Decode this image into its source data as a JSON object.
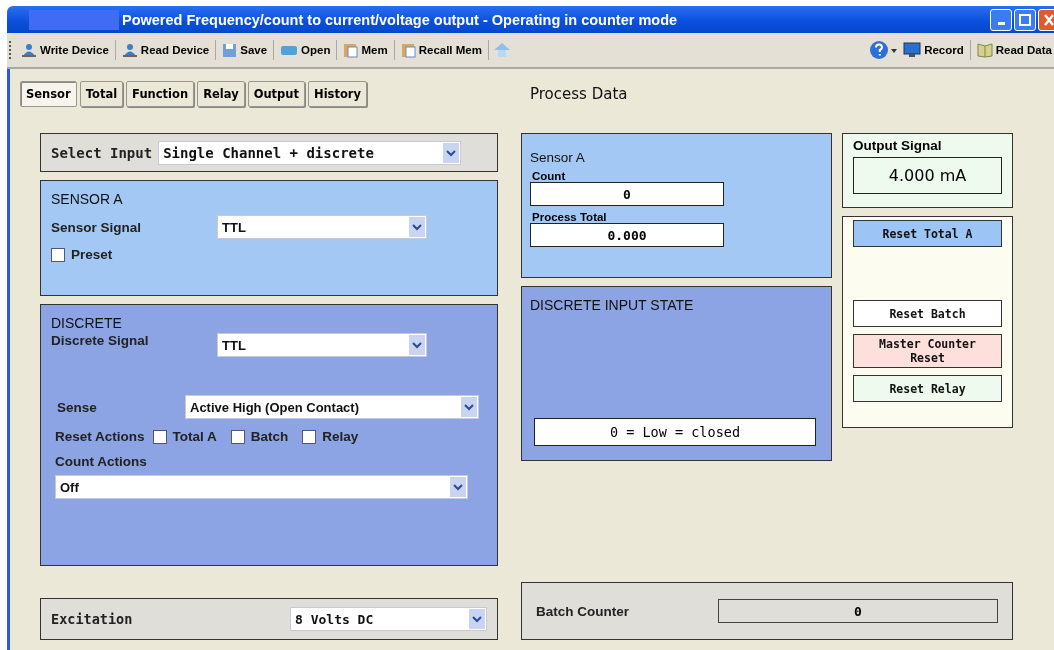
{
  "window": {
    "title": "Powered  Frequency/count to  current/voltage output - Operating in counter mode"
  },
  "toolbar": {
    "left": [
      "Write Device",
      "Read Device",
      "Save",
      "Open",
      "Mem",
      "Recall Mem"
    ],
    "right": [
      "Record",
      "Read Data"
    ]
  },
  "tabs": [
    {
      "label": "Sensor",
      "selected": true
    },
    {
      "label": "Total",
      "selected": false
    },
    {
      "label": "Function",
      "selected": false
    },
    {
      "label": "Relay",
      "selected": false
    },
    {
      "label": "Output",
      "selected": false
    },
    {
      "label": "History",
      "selected": false
    }
  ],
  "process_data_heading": "Process Data",
  "select_input": {
    "label": "Select Input",
    "value": "Single Channel  + discrete"
  },
  "sensor_a": {
    "title": "SENSOR A",
    "signal_label": "Sensor Signal",
    "signal_value": "TTL",
    "preset": {
      "label": "Preset",
      "checked": false
    }
  },
  "discrete": {
    "title": "DISCRETE",
    "signal_label": "Discrete Signal",
    "signal_value": "TTL",
    "sense_label": "Sense",
    "sense_value": "Active High (Open Contact)",
    "reset_actions_label": "Reset Actions",
    "reset_actions": [
      {
        "label": "Total A",
        "checked": false
      },
      {
        "label": "Batch",
        "checked": false
      },
      {
        "label": "Relay",
        "checked": false
      }
    ],
    "count_actions_label": "Count Actions",
    "count_actions_value": "Off"
  },
  "excitation": {
    "label": "Excitation",
    "value": "8  Volts DC"
  },
  "process_sensor_a": {
    "title": "Sensor A",
    "count_label": "Count",
    "count": "0",
    "total_label": "Process Total",
    "total": "0.000"
  },
  "discrete_input_state": {
    "title": "DISCRETE INPUT STATE",
    "value": "0 =  Low = closed"
  },
  "output_signal": {
    "label": "Output Signal",
    "value": "4.000  mA"
  },
  "reset_buttons": [
    {
      "label": "Reset Total A",
      "color": "#9cc4f4"
    },
    {
      "label": "Reset Batch",
      "color": "#ffffff"
    },
    {
      "label": "Master Counter Reset",
      "color": "#fde0dc"
    },
    {
      "label": "Reset  Relay",
      "color": "#eefaee"
    }
  ],
  "batch_counter": {
    "label": "Batch Counter",
    "value": "0"
  }
}
